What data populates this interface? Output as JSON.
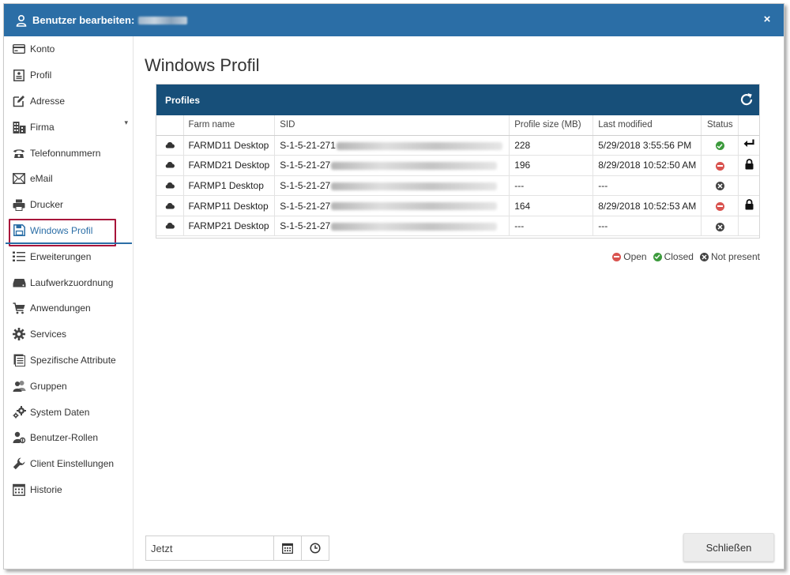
{
  "window": {
    "title": "Benutzer bearbeiten:",
    "close_glyph": "×"
  },
  "sidebar": {
    "items": [
      {
        "label": "Konto",
        "icon": "credit-card-icon"
      },
      {
        "label": "Profil",
        "icon": "profile-card-icon"
      },
      {
        "label": "Adresse",
        "icon": "edit-icon"
      },
      {
        "label": "Firma",
        "icon": "building-icon"
      },
      {
        "label": "Telefonnummern",
        "icon": "phone-icon"
      },
      {
        "label": "eMail",
        "icon": "envelope-icon"
      },
      {
        "label": "Drucker",
        "icon": "printer-icon"
      },
      {
        "label": "Windows Profil",
        "icon": "floppy-disk-icon"
      },
      {
        "label": "Erweiterungen",
        "icon": "list-icon"
      },
      {
        "label": "Laufwerkzuordnung",
        "icon": "drive-icon"
      },
      {
        "label": "Anwendungen",
        "icon": "cart-icon"
      },
      {
        "label": "Services",
        "icon": "gear-icon"
      },
      {
        "label": "Spezifische Attribute",
        "icon": "document-icon"
      },
      {
        "label": "Gruppen",
        "icon": "users-icon"
      },
      {
        "label": "System Daten",
        "icon": "gears-icon"
      },
      {
        "label": "Benutzer-Rollen",
        "icon": "user-roles-icon"
      },
      {
        "label": "Client Einstellungen",
        "icon": "wrench-icon"
      },
      {
        "label": "Historie",
        "icon": "calendar-grid-icon"
      }
    ],
    "active": "Windows Profil"
  },
  "main": {
    "title": "Windows Profil",
    "panel_title": "Profiles",
    "columns": [
      "",
      "Farm name",
      "SID",
      "Profile size (MB)",
      "Last modified",
      "Status",
      ""
    ],
    "rows": [
      {
        "farm": "FARMD11 Desktop",
        "sid": "S-1-5-21-271",
        "size": "228",
        "modified": "5/29/2018 3:55:56 PM",
        "status": "closed",
        "action": "reply-arrow"
      },
      {
        "farm": "FARMD21 Desktop",
        "sid": "S-1-5-21-27",
        "size": "196",
        "modified": "8/29/2018 10:52:50 AM",
        "status": "open",
        "action": "lock"
      },
      {
        "farm": "FARMP1 Desktop",
        "sid": "S-1-5-21-27",
        "size": "---",
        "modified": "---",
        "status": "not-present",
        "action": ""
      },
      {
        "farm": "FARMP11 Desktop",
        "sid": "S-1-5-21-27",
        "size": "164",
        "modified": "8/29/2018 10:52:53 AM",
        "status": "open",
        "action": "lock"
      },
      {
        "farm": "FARMP21 Desktop",
        "sid": "S-1-5-21-27",
        "size": "---",
        "modified": "---",
        "status": "not-present",
        "action": ""
      }
    ],
    "legend": {
      "open": "Open",
      "closed": "Closed",
      "not_present": "Not present"
    }
  },
  "footer": {
    "date_value": "Jetzt",
    "close_label": "Schließen"
  },
  "colors": {
    "titlebar": "#2b6ea6",
    "panel_header": "#174f79",
    "status_open": "#d9534f",
    "status_closed": "#3c9a3c",
    "status_not_present": "#444444",
    "active_outline": "#a8143a"
  }
}
